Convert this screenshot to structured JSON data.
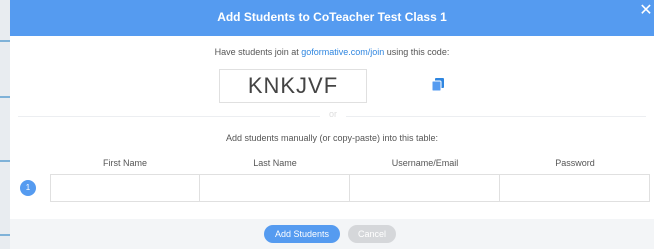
{
  "modal": {
    "title": "Add Students to CoTeacher Test Class 1",
    "close_glyph": "✕"
  },
  "join": {
    "prefix": "Have students join at ",
    "link_text": "goformative.com/join",
    "suffix": " using this code:",
    "code": "KNKJVF"
  },
  "divider": {
    "label": "or"
  },
  "manual": {
    "instructions": "Add students manually (or copy-paste) into this table:"
  },
  "table": {
    "headers": [
      "First Name",
      "Last Name",
      "Username/Email",
      "Password"
    ],
    "rows": [
      {
        "number": "1",
        "first_name": "",
        "last_name": "",
        "username": "",
        "password": ""
      }
    ]
  },
  "footer": {
    "add_label": "Add Students",
    "cancel_label": "Cancel"
  },
  "colors": {
    "accent": "#559bf0",
    "link": "#2f86e0",
    "cancel_bg": "#d5d7da"
  },
  "icons": {
    "copy": "copy-icon",
    "close": "close-icon"
  }
}
